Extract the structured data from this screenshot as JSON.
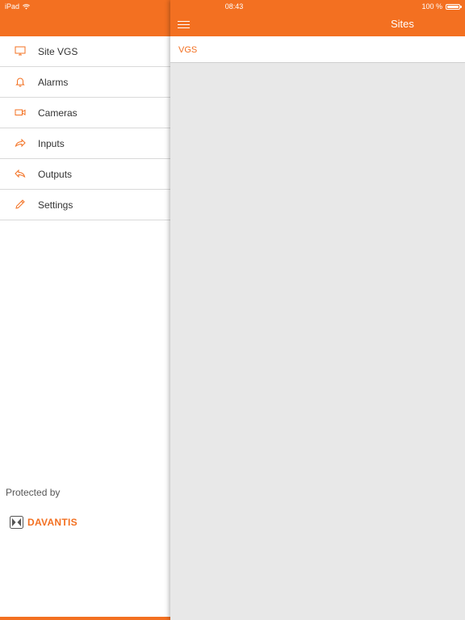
{
  "status_bar": {
    "device": "iPad",
    "time": "08:43",
    "battery": "100 %",
    "battery_level": 1.0
  },
  "sidebar": {
    "items": [
      {
        "label": "Site VGS",
        "icon": "monitor-icon"
      },
      {
        "label": "Alarms",
        "icon": "bell-icon"
      },
      {
        "label": "Cameras",
        "icon": "video-camera-icon"
      },
      {
        "label": "Inputs",
        "icon": "forward-arrow-icon"
      },
      {
        "label": "Outputs",
        "icon": "reply-arrow-icon"
      },
      {
        "label": "Settings",
        "icon": "pencil-icon"
      }
    ],
    "footer_text": "Protected by",
    "logo_text": "DAVANTIS"
  },
  "main": {
    "title": "Sites",
    "menu_icon": "hamburger-icon",
    "rows": [
      {
        "label": "VGS"
      }
    ]
  },
  "colors": {
    "accent": "#f37021",
    "background": "#e8e8e8"
  }
}
